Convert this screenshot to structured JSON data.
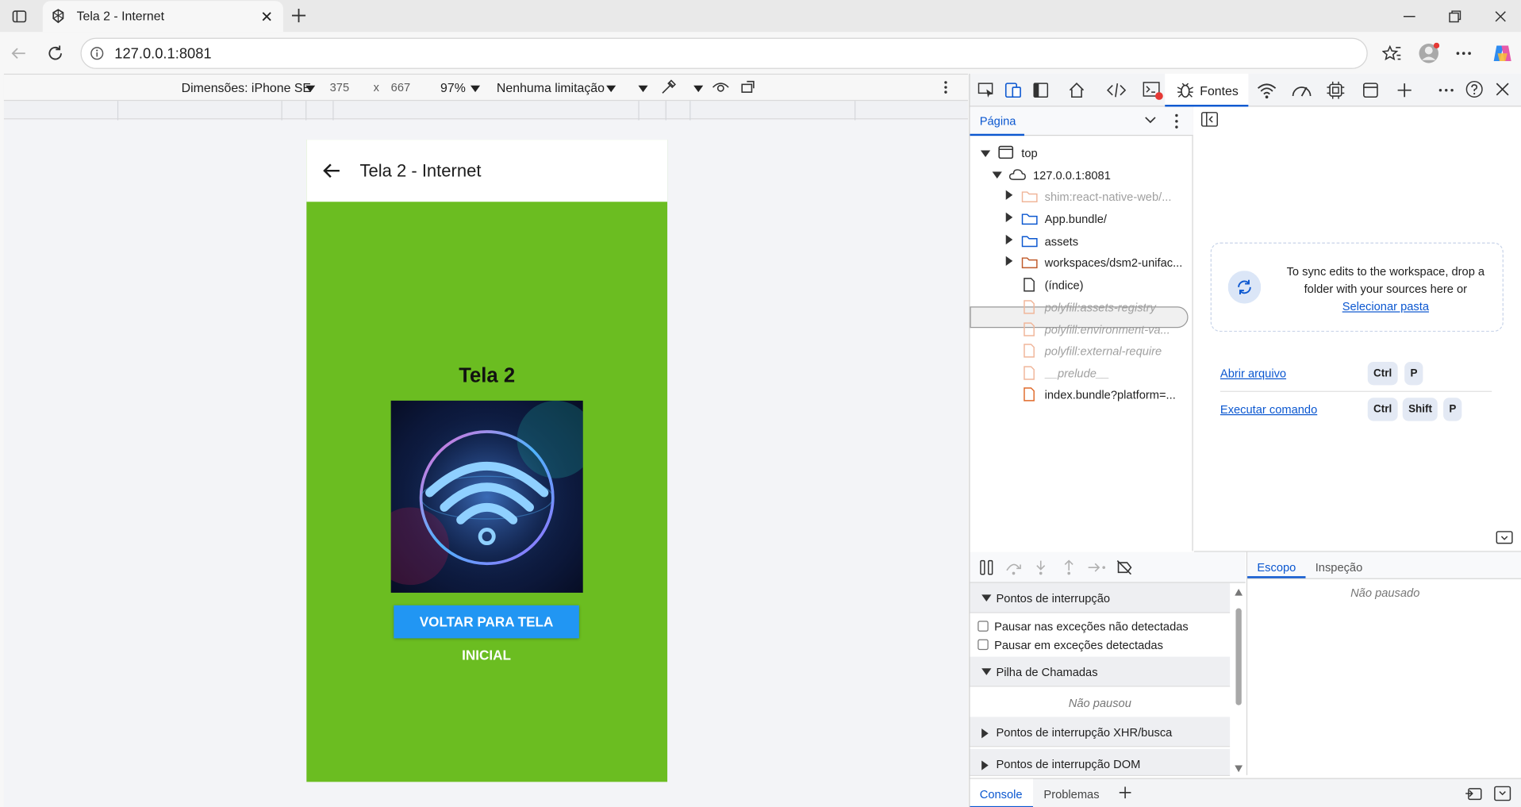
{
  "browser": {
    "tab_title": "Tela 2 - Internet",
    "url": "127.0.0.1:8081"
  },
  "device_toolbar": {
    "device_label": "Dimensões: iPhone SE",
    "width": "375",
    "times": "x",
    "height": "667",
    "zoom": "97%",
    "throttle": "Nenhuma limitação"
  },
  "app": {
    "header_title": "Tela 2 - Internet",
    "screen_title": "Tela 2",
    "button_label": "VOLTAR PARA TELA INICIAL",
    "background_color": "#6bbd21",
    "button_color": "#2196f3"
  },
  "devtools": {
    "active_tab": "Fontes",
    "nav_tab": "Página",
    "tree": {
      "top": "top",
      "origin": "127.0.0.1:8081",
      "items": [
        "shim:react-native-web/...",
        "App.bundle/",
        "assets",
        "workspaces/dsm2-unifac...",
        "(índice)",
        "polyfill:assets-registry",
        "polyfill:environment-va...",
        "polyfill:external-require",
        "__prelude__",
        "index.bundle?platform=..."
      ]
    },
    "sync_text": "To sync edits to the workspace, drop a folder with your sources here or",
    "sync_link": "Selecionar pasta",
    "open_file": "Abrir arquivo",
    "run_command": "Executar comando",
    "keys": {
      "ctrl": "Ctrl",
      "p": "P",
      "shift": "Shift"
    },
    "debugger": {
      "breakpoints": "Pontos de interrupção",
      "pause_uncaught": "Pausar nas exceções não detectadas",
      "pause_caught": "Pausar em exceções detectadas",
      "call_stack": "Pilha de Chamadas",
      "not_paused": "Não pausou",
      "xhr": "Pontos de interrupção XHR/busca",
      "dom": "Pontos de interrupção DOM"
    },
    "scope": {
      "tab1": "Escopo",
      "tab2": "Inspeção",
      "status": "Não pausado"
    },
    "drawer": {
      "console": "Console",
      "problems": "Problemas"
    }
  }
}
